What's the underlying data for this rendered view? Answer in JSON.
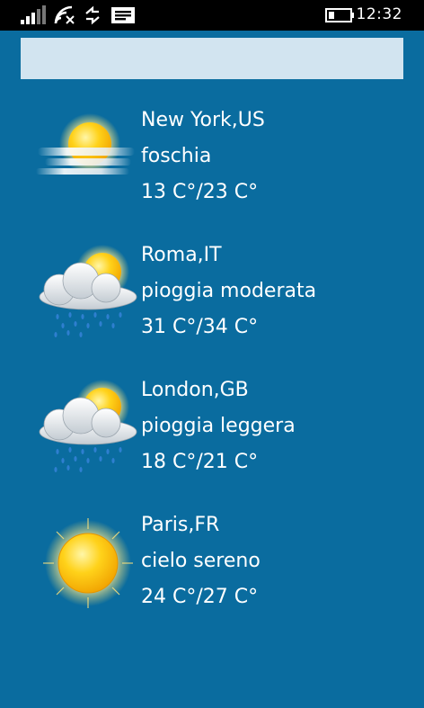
{
  "status_bar": {
    "time": "12:32",
    "icons": [
      "signal-icon",
      "wifi-icon",
      "data-sense-icon",
      "message-icon",
      "battery-icon"
    ]
  },
  "search": {
    "value": "",
    "placeholder": ""
  },
  "colors": {
    "background": "#0a6c9f",
    "search_box": "#d2e4f0",
    "status_bar": "#000000",
    "text": "#ffffff"
  },
  "cities": [
    {
      "name": "New York,US",
      "condition": "foschia",
      "temps": "13 C°/23 C°",
      "icon": "mist-icon"
    },
    {
      "name": "Roma,IT",
      "condition": "pioggia moderata",
      "temps": "31 C°/34 C°",
      "icon": "sun-cloud-rain-icon"
    },
    {
      "name": "London,GB",
      "condition": "pioggia leggera",
      "temps": "18 C°/21 C°",
      "icon": "sun-cloud-rain-icon"
    },
    {
      "name": "Paris,FR",
      "condition": "cielo sereno",
      "temps": "24 C°/27 C°",
      "icon": "sun-icon"
    }
  ]
}
